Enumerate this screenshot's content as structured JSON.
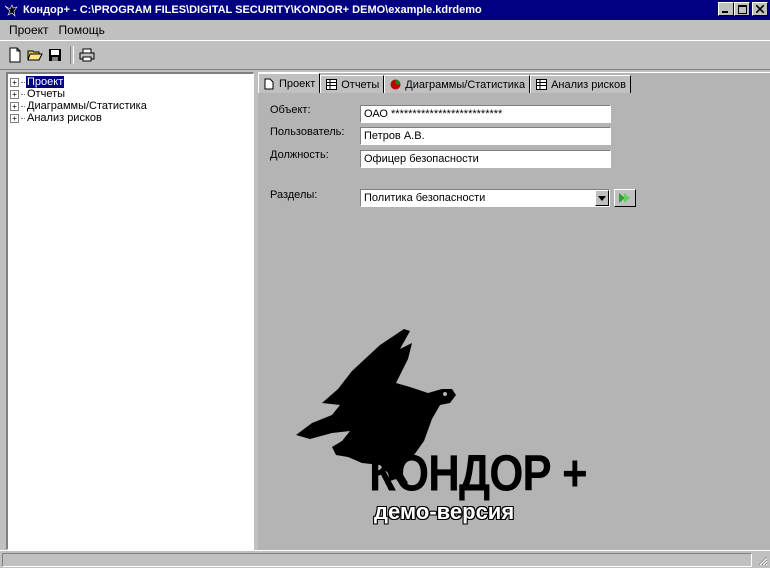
{
  "window": {
    "title": "Кондор+ - C:\\PROGRAM FILES\\DIGITAL SECURITY\\KONDOR+ DEMO\\example.kdrdemo",
    "buttons": {
      "minimize": "_",
      "maximize": "□",
      "close": "×"
    }
  },
  "menu": {
    "items": [
      {
        "label": "Проект"
      },
      {
        "label": "Помощь"
      }
    ]
  },
  "toolbar": {
    "icons": [
      "new-document-icon",
      "open-folder-icon",
      "save-disk-icon",
      "print-icon"
    ]
  },
  "tree": {
    "items": [
      {
        "label": "Проект",
        "selected": true
      },
      {
        "label": "Отчеты",
        "selected": false
      },
      {
        "label": "Диаграммы/Статистика",
        "selected": false
      },
      {
        "label": "Анализ рисков",
        "selected": false
      }
    ]
  },
  "tabs": [
    {
      "label": "Проект",
      "icon": "document-icon",
      "active": true
    },
    {
      "label": "Отчеты",
      "icon": "table-icon",
      "active": false
    },
    {
      "label": "Диаграммы/Статистика",
      "icon": "pie-chart-icon",
      "active": false
    },
    {
      "label": "Анализ рисков",
      "icon": "table-icon",
      "active": false
    }
  ],
  "form": {
    "object_label": "Объект:",
    "object_value": "ОАО **************************",
    "user_label": "Пользователь:",
    "user_value": "Петров А.В.",
    "position_label": "Должность:",
    "position_value": "Офицер безопасности",
    "sections_label": "Разделы:",
    "sections_value": "Политика безопасности"
  },
  "logo": {
    "name": "КОНДОР +",
    "subtitle": "демо-версия"
  },
  "colors": {
    "titlebar": "#000080",
    "face": "#c0c0c0",
    "pane": "#b4b4b4",
    "go_arrow": "#40b040",
    "chart_red": "#c00000"
  }
}
